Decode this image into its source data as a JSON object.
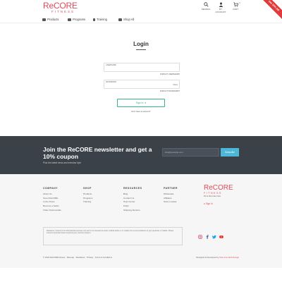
{
  "header": {
    "logo_main": "ReCORE",
    "logo_sub": "FITNESS",
    "icons": [
      {
        "name": "search-icon",
        "label": "SEARCH"
      },
      {
        "name": "account-icon",
        "label": "MY ACCOUNT"
      },
      {
        "name": "cart-icon",
        "label": "CART",
        "badge": "0"
      }
    ],
    "ribbon": "Get 10% Off"
  },
  "nav": {
    "items": [
      {
        "label": "Products"
      },
      {
        "label": "Programs"
      },
      {
        "label": "Training"
      },
      {
        "label": "Shop All"
      }
    ]
  },
  "login": {
    "title": "Login",
    "username_label": "USERNAME",
    "forgot_username": "FORGOT USERNAME?",
    "password_label": "PASSWORD",
    "show_label": "Show",
    "forgot_password": "FORGOT PASSWORD?",
    "signin_label": "Sign In",
    "no_account": "Don't have an account?"
  },
  "newsletter": {
    "title": "Join the ReCORE newsletter and get a 10% coupon",
    "subtitle": "Plus the latest news and exercise tips!",
    "input_placeholder": "info@example.com",
    "subscribe_label": "Subscribe"
  },
  "footer": {
    "columns": [
      {
        "heading": "COMPANY",
        "links": [
          "About Us",
          "Team ReCORE",
          "In the Press",
          "Become a Seller",
          "Video Testimonials"
        ]
      },
      {
        "heading": "SHOP",
        "links": [
          "Products",
          "Programs",
          "Training"
        ]
      },
      {
        "heading": "RESOURCES",
        "links": [
          "Blog",
          "Contact Us",
          "Help Center",
          "FAQs",
          "Shipping Returns"
        ]
      },
      {
        "heading": "PARTNER",
        "links": [
          "Wholesale",
          "Affiliates",
          "Store Locator"
        ]
      }
    ],
    "logo_main": "ReCORE",
    "logo_sub": "FITNESS",
    "logo_tag": "Fit to the inner core",
    "signin_label": "Sign In",
    "disclaimer": "Disclaimer: Content is for informational purposes only and is not intended as either medical advice or to replace the recommendations of your physician or midwife. Please consult a physician before beginning any exercise program.",
    "copyright": "© 2023 ReCORE Fitness",
    "legal_links": [
      "Sitemap",
      "Disclaimer",
      "Privacy",
      "Terms & Conditions"
    ],
    "credit_prefix": "Designed & Developed by",
    "credit_name": "New Line Web Design"
  },
  "colors": {
    "brand": "#e04a5a",
    "accent_green": "#35b28c",
    "newsletter_bg": "#3b4149",
    "subscribe": "#4cb7d6"
  }
}
